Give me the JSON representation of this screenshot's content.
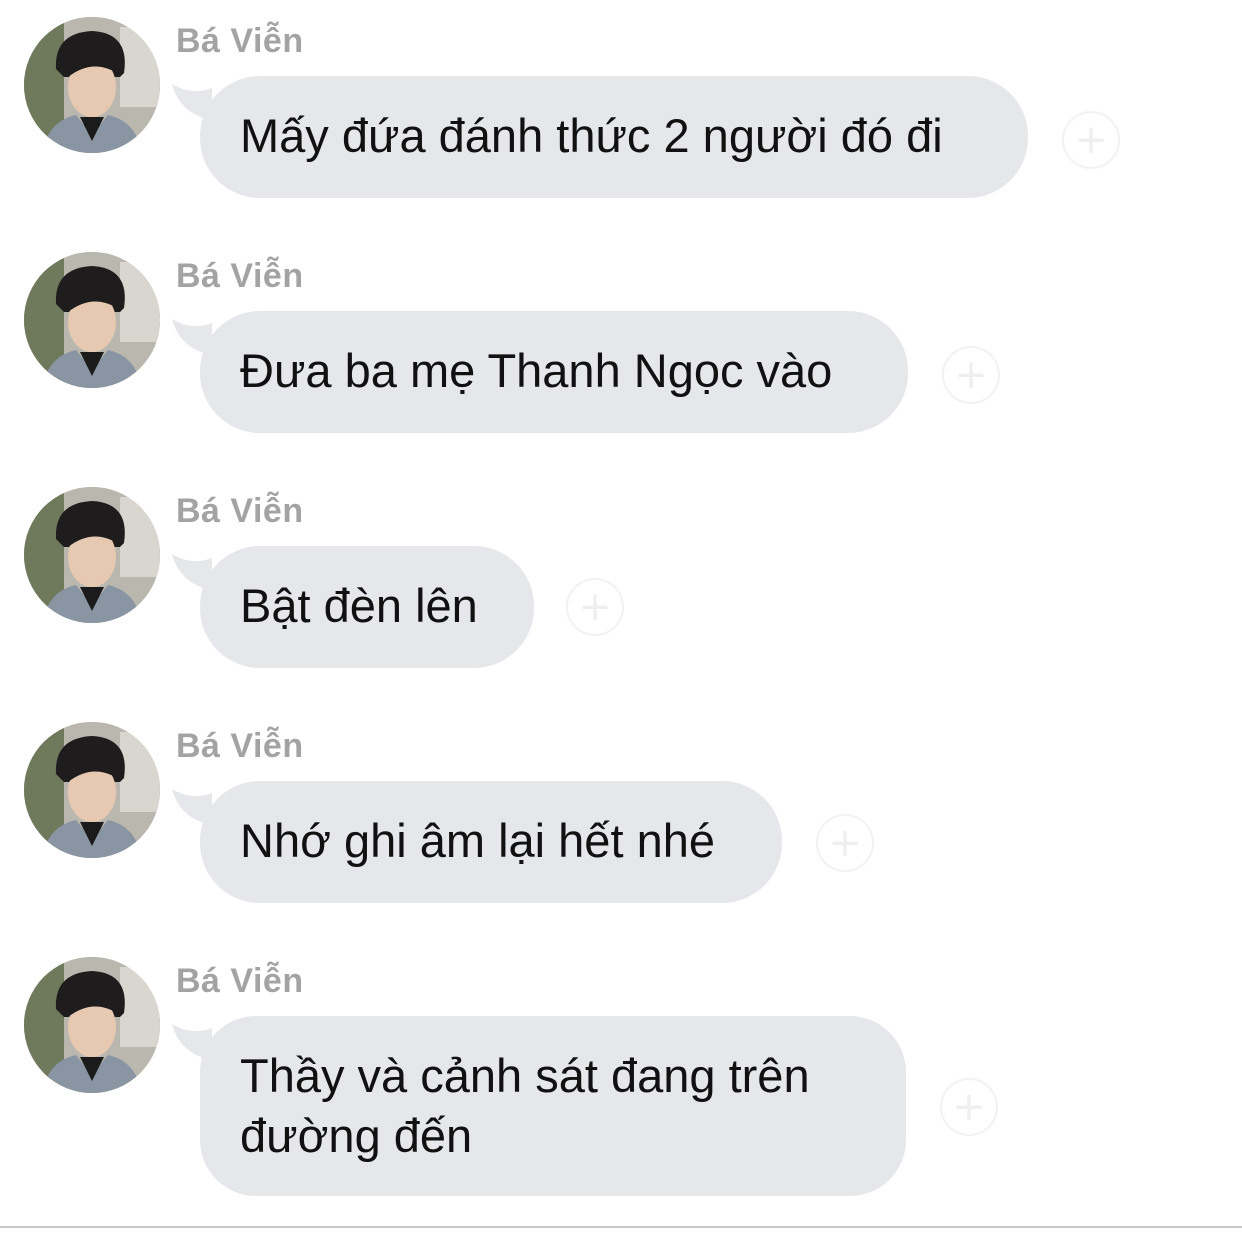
{
  "thread": {
    "messages": [
      {
        "sender": "Bá Viễn",
        "text": "Mấy đứa đánh thức 2 người đó đi",
        "avatar_icon": "user-avatar-photo",
        "react_icon": "add-reaction-icon"
      },
      {
        "sender": "Bá Viễn",
        "text": "Đưa ba mẹ Thanh Ngọc vào",
        "avatar_icon": "user-avatar-photo",
        "react_icon": "add-reaction-icon"
      },
      {
        "sender": "Bá Viễn",
        "text": "Bật đèn lên",
        "avatar_icon": "user-avatar-photo",
        "react_icon": "add-reaction-icon"
      },
      {
        "sender": "Bá Viễn",
        "text": "Nhớ ghi âm lại hết nhé",
        "avatar_icon": "user-avatar-photo",
        "react_icon": "add-reaction-icon"
      },
      {
        "sender": "Bá Viễn",
        "text": "Thầy và cảnh sát đang trên đường đến",
        "avatar_icon": "user-avatar-photo",
        "react_icon": "add-reaction-icon"
      }
    ]
  },
  "colors": {
    "bubble": "#e5e7eb",
    "sender": "#a3a3a3",
    "text": "#111111",
    "background": "#ffffff"
  },
  "react_symbol": "+"
}
